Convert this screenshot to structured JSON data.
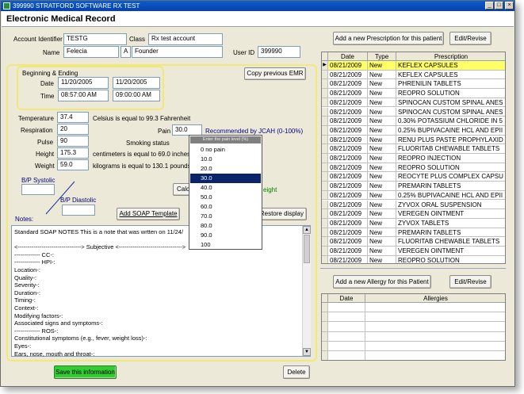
{
  "window": {
    "title": "399990 STRATFORD SOFTWARE RX TEST",
    "heading": "Electronic Medical Record"
  },
  "controls": {
    "minimize": "_",
    "maximize": "□",
    "close": "×"
  },
  "patient": {
    "account_label": "Account Identifier",
    "account_value": "TESTG",
    "class_label": "Class",
    "class_value": "Rx test account",
    "name_label": "Name",
    "first_name": "Felecia",
    "middle_initial": "A",
    "last_name": "Founder",
    "userid_label": "User ID",
    "userid_value": "399990"
  },
  "copy_emr": "Copy previous EMR",
  "dates": {
    "heading": "Beginning & Ending",
    "date_label": "Date",
    "time_label": "Time",
    "begin_date": "11/20/2005",
    "end_date": "11/20/2005",
    "begin_time": "08:57:00 AM",
    "end_time": "09:00:00 AM"
  },
  "vitals": {
    "temperature_label": "Temperature",
    "temperature": "37.4",
    "temperature_note": "Celsius is equal to 99.3 Fahrenheit",
    "respiration_label": "Respiration",
    "respiration": "20",
    "pulse_label": "Pulse",
    "pulse": "90",
    "height_label": "Height",
    "height": "175.3",
    "height_note": "centimeters is equal to 69.0 inches",
    "weight_label": "Weight",
    "weight": "59.0",
    "weight_note": "kilograms is equal to 130.1 pounds",
    "pain_label": "Pain",
    "pain": "30.0",
    "pain_note": "Recommended by JCAH (0-100%)",
    "smoking_label": "Smoking status",
    "bp_systolic_label": "B/P Systolic",
    "bp_diastolic_label": "B/P Diastolic",
    "calc_partial": "Calc",
    "weight_partial": "eight"
  },
  "pain_dropdown": {
    "header": "Enter the pain level (%)",
    "options": [
      "0  no pain",
      "10.0",
      "20.0",
      "30.0",
      "40.0",
      "50.0",
      "60.0",
      "70.0",
      "80.0",
      "90.0",
      "100"
    ],
    "selected_index": 3
  },
  "soap": {
    "add_template": "Add SOAP Template",
    "restore": "Restore display"
  },
  "notes": {
    "label": "Notes:",
    "lines": [
      "Standard SOAP NOTES  This is a note that was wrtten on 11/24/",
      "",
      "<--------------------------------> Subjective <-------------------------------->",
      "------------- CC-:",
      "------------- HPI-:",
      "Location-:",
      "Quality-:",
      "Severity-:",
      "Duration-:",
      "Timing-:",
      "Context-:",
      "Modifying factors-:",
      "Associated signs and symptoms-:",
      "------------- ROS-:",
      "Constitutional symptoms (e.g., fever, weight loss)-:",
      "Eyes-:",
      "Ears, nose, mouth and throat-:"
    ]
  },
  "actions": {
    "save": "Save this information",
    "delete": "Delete"
  },
  "prescriptions": {
    "add_button": "Add a new Prescription for this patient",
    "edit_button": "Edit/Revise",
    "columns": [
      "Date",
      "Type",
      "Prescription"
    ],
    "rows": [
      [
        "08/21/2009",
        "New",
        "KEFLEX CAPSULES"
      ],
      [
        "08/21/2009",
        "New",
        "KEFLEX CAPSULES"
      ],
      [
        "08/21/2009",
        "New",
        "PHRENILIN TABLETS"
      ],
      [
        "08/21/2009",
        "New",
        "REOPRO SOLUTION"
      ],
      [
        "08/21/2009",
        "New",
        "SPINOCAN CUSTOM SPINAL ANES"
      ],
      [
        "08/21/2009",
        "New",
        "SPINOCAN CUSTOM SPINAL ANES"
      ],
      [
        "08/21/2009",
        "New",
        "0.30% POTASSIUM CHLORIDE IN 5"
      ],
      [
        "08/21/2009",
        "New",
        "0.25% BUPIVACAINE HCL AND EPII"
      ],
      [
        "08/21/2009",
        "New",
        "RENU PLUS PASTE PROPHYLAXID"
      ],
      [
        "08/21/2009",
        "New",
        "FLUORITAB CHEWABLE TABLETS"
      ],
      [
        "08/21/2009",
        "New",
        "REOPRO INJECTION"
      ],
      [
        "08/21/2009",
        "New",
        "REOPRO SOLUTION"
      ],
      [
        "08/21/2009",
        "New",
        "REOCYTE PLUS COMPLEX CAPSU"
      ],
      [
        "08/21/2009",
        "New",
        "PREMARIN TABLETS"
      ],
      [
        "08/21/2009",
        "New",
        "0.25% BUPIVACAINE HCL AND EPII"
      ],
      [
        "08/21/2009",
        "New",
        "ZYVOX ORAL SUSPENSION"
      ],
      [
        "08/21/2009",
        "New",
        "VEREGEN OINTMENT"
      ],
      [
        "08/21/2009",
        "New",
        "ZYVOX TABLETS"
      ],
      [
        "08/21/2009",
        "New",
        "PREMARIN TABLETS"
      ],
      [
        "08/21/2009",
        "New",
        "FLUORITAB CHEWABLE TABLETS"
      ],
      [
        "08/21/2009",
        "New",
        "VEREGEN OINTMENT"
      ],
      [
        "08/21/2009",
        "New",
        "REOPRO SOLUTION"
      ]
    ]
  },
  "allergies": {
    "add_button": "Add a new Allergy for this Patient",
    "edit_button": "Edit/Revise",
    "columns": [
      "Date",
      "Allergies"
    ]
  },
  "colors": {
    "title_bar": "#0a5ecf",
    "panel_border": "#f2e87a",
    "selected_row": "#ffff66",
    "save_button": "#33cc33",
    "dropdown_highlight": "#0a246a"
  }
}
